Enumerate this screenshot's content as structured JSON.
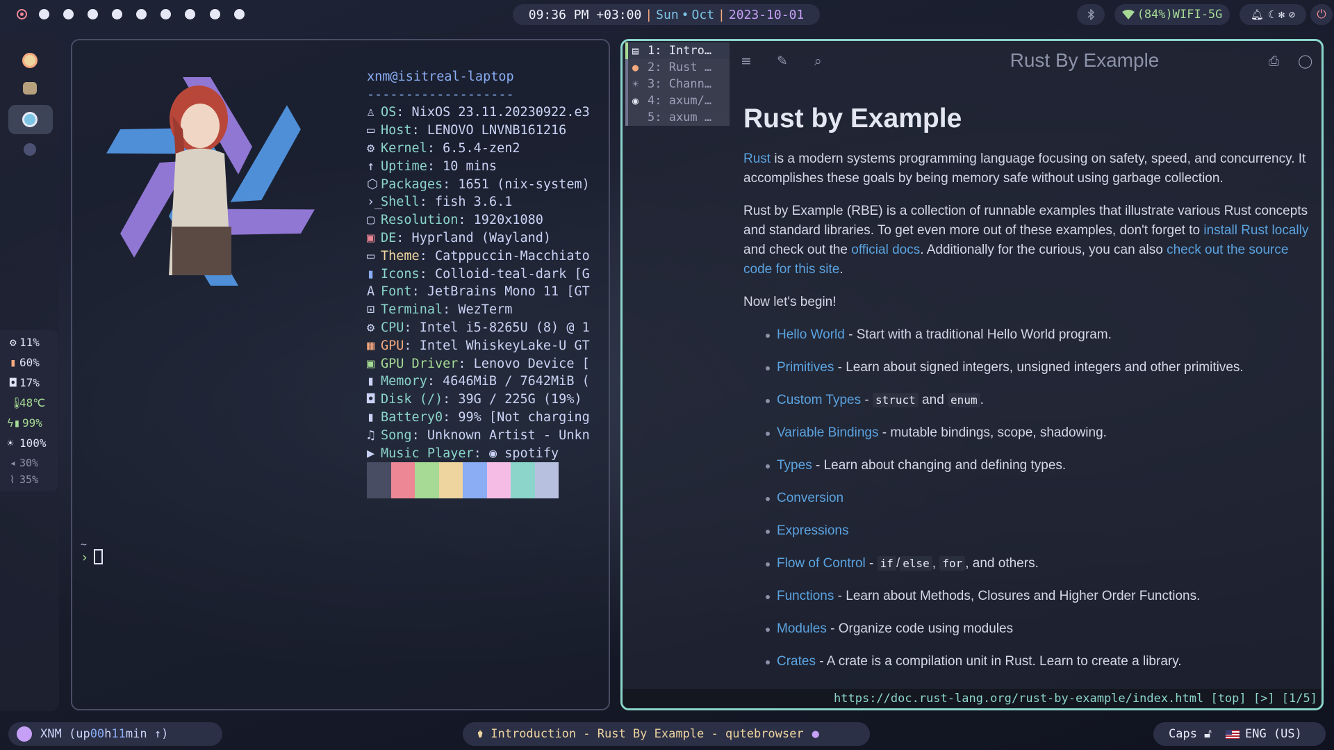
{
  "topbar": {
    "workspace_count": 10,
    "clock": {
      "time": "09:36 PM +03:00",
      "day": "Sun",
      "dot": "•",
      "month": "Oct",
      "date": "2023-10-01"
    },
    "bluetooth_icon": "bluetooth-icon",
    "wifi": "(84%)WIFI-5G",
    "tray_icons": [
      "bell-icon",
      "moon-icon",
      "fan-icon",
      "eye-off-icon"
    ],
    "power_icon": "power-icon"
  },
  "sidebar": {
    "apps": [
      "firefox-icon",
      "folder-icon",
      "qutebrowser-icon",
      "swappy-icon"
    ],
    "stats": [
      {
        "icon": "cpu-icon",
        "value": "11%"
      },
      {
        "icon": "memory-icon",
        "value": "60%"
      },
      {
        "icon": "disk-icon",
        "value": "17%"
      },
      {
        "icon": "temperature-icon",
        "value": "48℃"
      },
      {
        "icon": "battery-icon",
        "value": "99%"
      },
      {
        "icon": "brightness-icon",
        "value": "100%"
      },
      {
        "icon": "volume-icon",
        "value": "30%"
      },
      {
        "icon": "mic-icon",
        "value": "35%"
      }
    ],
    "colors": {
      "cpu": "#eed49f",
      "memory": "#f5a97f",
      "brightness": "#f0f2fb"
    }
  },
  "terminal": {
    "user_host": "xnm@isitreal-laptop",
    "separator": "-------------------",
    "fetch": [
      {
        "icon": "nixos-icon",
        "key": "OS",
        "value": " NixOS 23.11.20230922.e3"
      },
      {
        "icon": "laptop-icon",
        "key": "Host",
        "value": " LENOVO LNVNB161216"
      },
      {
        "icon": "gear-icon",
        "key": "Kernel",
        "value": " 6.5.4-zen2"
      },
      {
        "icon": "arrow-up-icon",
        "key": "Uptime",
        "value": " 10 mins"
      },
      {
        "icon": "package-icon",
        "key": "Packages",
        "value": " 1651 (nix-system)"
      },
      {
        "icon": "shell-icon",
        "key": "Shell",
        "value": " fish 3.6.1"
      },
      {
        "icon": "monitor-icon",
        "key": "Resolution",
        "value": " 1920x1080"
      },
      {
        "icon": "desktop-icon",
        "key": "DE",
        "value": " Hyprland (Wayland)"
      },
      {
        "icon": "window-icon",
        "key": "Theme",
        "value": " Catppuccin-Macchiato"
      },
      {
        "icon": "file-icon",
        "key": "Icons",
        "value": " Colloid-teal-dark [G"
      },
      {
        "icon": "font-icon",
        "key": "Font",
        "value": " JetBrains Mono 11 [GT"
      },
      {
        "icon": "terminal-icon",
        "key": "Terminal",
        "value": " WezTerm"
      },
      {
        "icon": "cpu-icon",
        "key": "CPU",
        "value": " Intel i5-8265U (8) @ 1"
      },
      {
        "icon": "gpu-icon",
        "key": "GPU",
        "value": " Intel WhiskeyLake-U GT"
      },
      {
        "icon": "gpu-driver-icon",
        "key": "GPU Driver",
        "value": " Lenovo Device ["
      },
      {
        "icon": "memory-icon",
        "key": "Memory",
        "value": " 4646MiB / 7642MiB ("
      },
      {
        "icon": "disk-icon",
        "key": "Disk (/)",
        "value": " 39G / 225G (19%)"
      },
      {
        "icon": "battery-icon",
        "key": "Battery0",
        "value": " 99% [Not charging"
      },
      {
        "icon": "music-note-icon",
        "key": "Song",
        "value": " Unknown Artist - Unkn"
      },
      {
        "icon": "play-icon",
        "key": "Music Player",
        "value": " spotify"
      }
    ],
    "palette": [
      "#494d64",
      "#ed8796",
      "#a6da95",
      "#eed49f",
      "#8aadf4",
      "#f5bde6",
      "#8bd5ca",
      "#b8c0e0"
    ],
    "prompt_dir": "~",
    "prompt_symbol": "›"
  },
  "browser": {
    "tabs": [
      {
        "icon": "page-icon",
        "label": "1: Intro…"
      },
      {
        "icon": "rust-icon",
        "label": "2: Rust …"
      },
      {
        "icon": "sun-icon",
        "label": "3: Chann…"
      },
      {
        "icon": "github-icon",
        "label": "4: axum/…"
      },
      {
        "icon": "",
        "label": "5: axum …"
      }
    ],
    "toolbar": {
      "title": "Rust By Example"
    },
    "content": {
      "heading": "Rust by Example",
      "p1_link": "Rust",
      "p1_text": " is a modern systems programming language focusing on safety, speed, and concurrency. It accomplishes these goals by being memory safe without using garbage collection.",
      "p2_a": "Rust by Example (RBE) is a collection of runnable examples that illustrate various Rust concepts and standard libraries. To get even more out of these examples, don't forget to ",
      "p2_link1": "install Rust locally",
      "p2_b": " and check out the ",
      "p2_link2": "official docs",
      "p2_c": ". Additionally for the curious, you can also ",
      "p2_link3": "check out the source code for this site",
      "p2_d": ".",
      "begin": "Now let's begin!",
      "items": [
        {
          "link": "Hello World",
          "text": " - Start with a traditional Hello World program."
        },
        {
          "link": "Primitives",
          "text": " - Learn about signed integers, unsigned integers and other primitives."
        },
        {
          "link": "Custom Types",
          "text": " - ",
          "code1": "struct",
          "mid": " and ",
          "code2": "enum",
          "end": "."
        },
        {
          "link": "Variable Bindings",
          "text": " - mutable bindings, scope, shadowing."
        },
        {
          "link": "Types",
          "text": " - Learn about changing and defining types."
        },
        {
          "link": "Conversion",
          "text": ""
        },
        {
          "link": "Expressions",
          "text": ""
        },
        {
          "link": "Flow of Control",
          "text": " - ",
          "code1": "if",
          "mid": "/",
          "code2": "else",
          "mid2": ", ",
          "code3": "for",
          "end": ", and others."
        },
        {
          "link": "Functions",
          "text": " - Learn about Methods, Closures and Higher Order Functions."
        },
        {
          "link": "Modules",
          "text": " - Organize code using modules"
        },
        {
          "link": "Crates",
          "text": " - A crate is a compilation unit in Rust. Learn to create a library."
        }
      ]
    },
    "statusbar": "https://doc.rust-lang.org/rust-by-example/index.html [top] [>] [1/5]"
  },
  "bottombar": {
    "user": "XNM",
    "uptime_prefix": "(up ",
    "uptime_h": "00",
    "uptime_mid": " h ",
    "uptime_m": "11",
    "uptime_suffix": " min ↑)",
    "window_title": "Introduction - Rust By Example - qutebrowser",
    "caps_label": "Caps",
    "layout": "ENG (US)",
    "flag_icon": "us-flag-icon"
  }
}
